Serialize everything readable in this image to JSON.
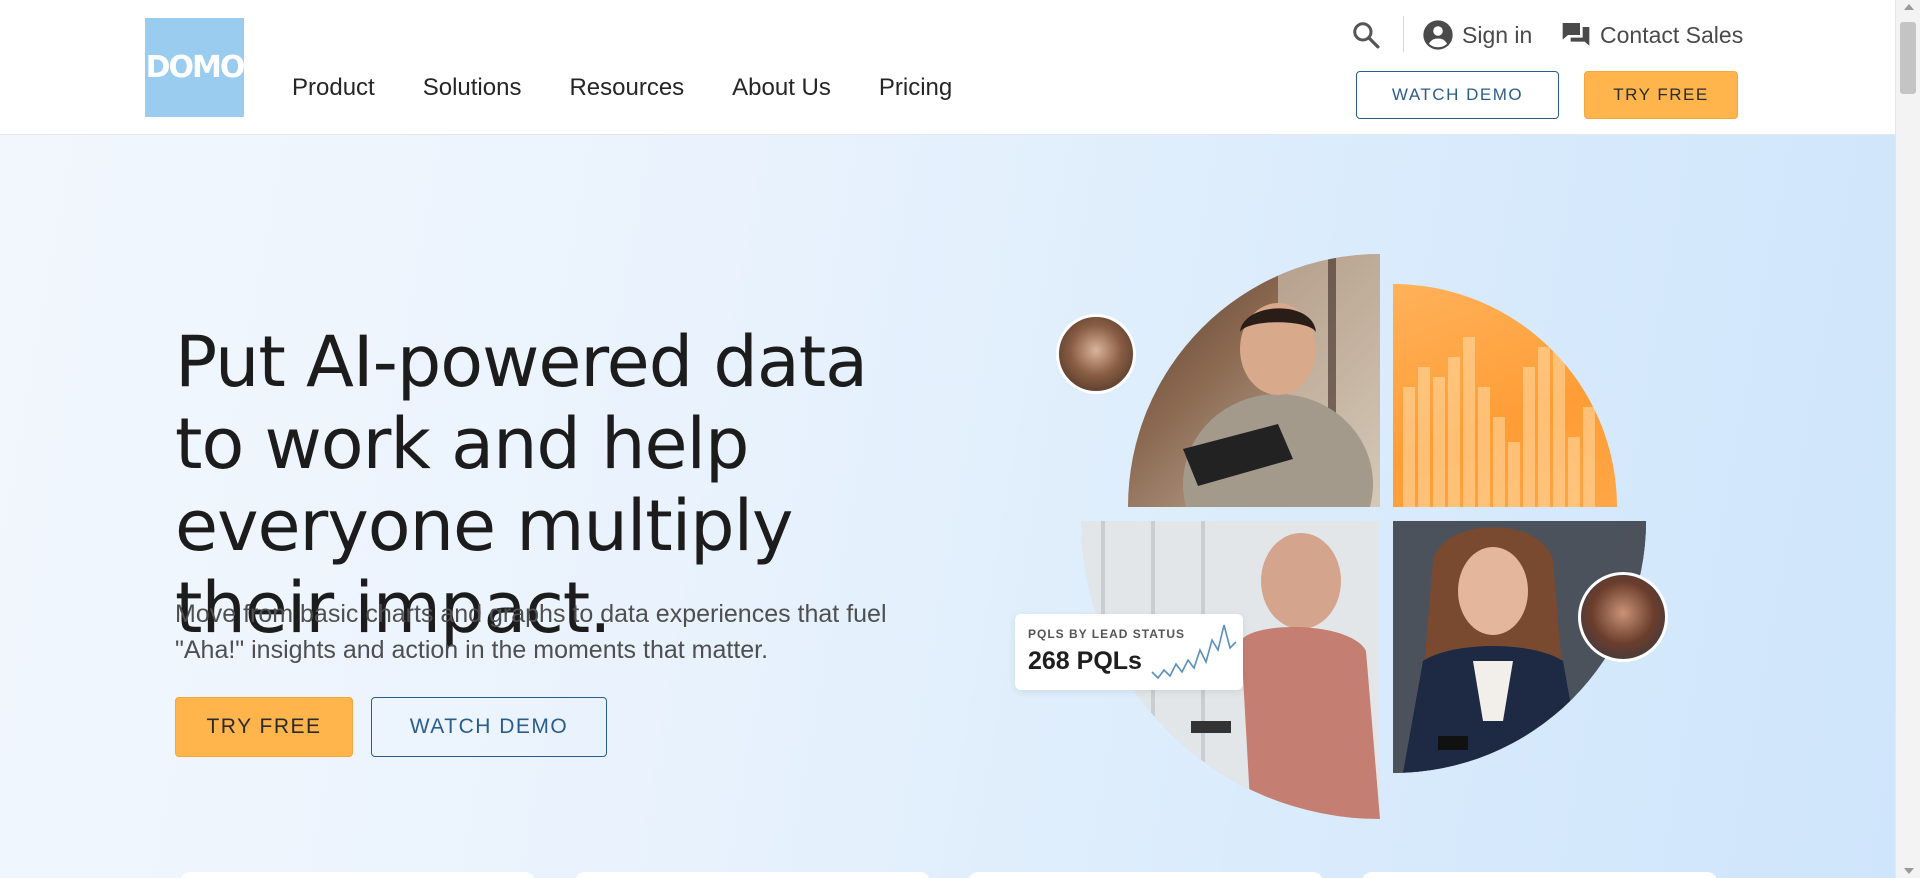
{
  "header": {
    "logo_text": "DOMO",
    "nav": [
      {
        "label": "Product"
      },
      {
        "label": "Solutions"
      },
      {
        "label": "Resources"
      },
      {
        "label": "About Us"
      },
      {
        "label": "Pricing"
      }
    ],
    "sign_in": "Sign in",
    "contact_sales": "Contact Sales",
    "watch_demo": "WATCH DEMO",
    "try_free": "TRY FREE"
  },
  "hero": {
    "title": "Put AI-powered data to work and help everyone multiply their impact.",
    "subtitle": "Move from basic charts and graphs to data experiences that fuel \"Aha!\" insights and action in the moments that matter.",
    "try_free": "TRY FREE",
    "watch_demo": "WATCH DEMO"
  },
  "pql_card": {
    "label": "PQLS BY LEAD STATUS",
    "value": "268 PQLs"
  },
  "colors": {
    "accent_orange": "#ffb44c",
    "accent_blue": "#2b5d8c",
    "logo_bg": "#99ccee"
  },
  "icons": {
    "search": "search-icon",
    "account": "account-circle-icon",
    "chat": "chat-bubbles-icon"
  }
}
